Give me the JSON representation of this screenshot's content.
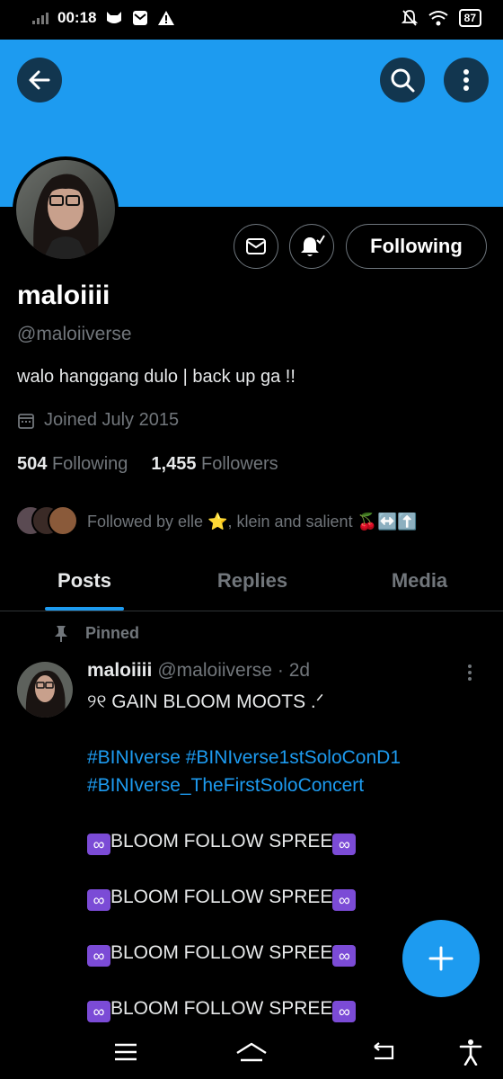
{
  "status_bar": {
    "time": "00:18",
    "battery": "87"
  },
  "profile": {
    "name": "maloiiii",
    "handle": "@maloiiverse",
    "bio": "walo hanggang dulo | back up ga !!",
    "joined": "Joined July 2015",
    "following_count": "504",
    "following_label": "Following",
    "followers_count": "1,455",
    "followers_label": "Followers",
    "followed_by": "Followed by elle ⭐, klein and salient 🍒↔️⬆️",
    "follow_button_label": "Following"
  },
  "tabs": [
    {
      "label": "Posts",
      "active": true
    },
    {
      "label": "Replies",
      "active": false
    },
    {
      "label": "Media",
      "active": false
    }
  ],
  "pinned_post": {
    "pinned_label": "Pinned",
    "author_name": "maloiiii",
    "author_handle": "@maloiiverse",
    "time": "· 2d",
    "lines": [
      "୨୧ GAIN BLOOM MOOTS .ᐟ",
      "",
      " #BINIverse #BINIverse1stSoloConD1",
      "#BINIverse_TheFirstSoloConcert",
      "",
      "BLOOM FOLLOW SPREE",
      "",
      "BLOOM FOLLOW SPREE",
      "",
      "BLOOM FOLLOW SPREE",
      "",
      "BLOOM FOLLOW SPREE"
    ]
  },
  "colors": {
    "accent": "#1d9bf0",
    "background": "#000000",
    "muted_text": "#71767b",
    "banner": "#1d9bf0"
  },
  "icons": {
    "back": "arrow-left-icon",
    "search": "search-icon",
    "more": "more-vertical-icon",
    "message": "envelope-icon",
    "notifications": "bell-check-icon",
    "calendar": "calendar-icon",
    "pin": "pin-icon",
    "compose": "plus-icon"
  }
}
